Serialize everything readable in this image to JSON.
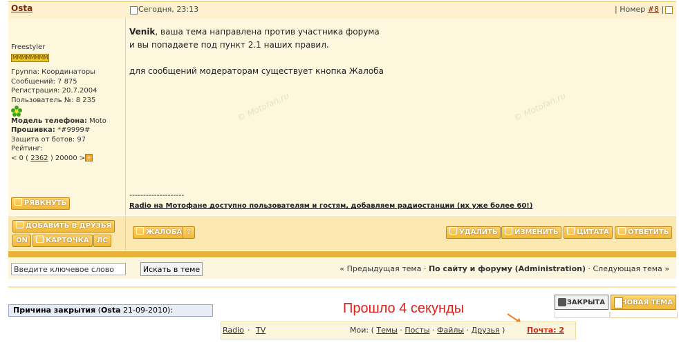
{
  "post": {
    "author": "Osta",
    "date": "Сегодня, 23:13",
    "number_label": "| Номер",
    "number_link": "#8",
    "number_sep": "|",
    "message": {
      "mention": "Venik",
      "line1_rest": ", ваша тема направлена против участника форума",
      "line2": "и вы попадаете под пункт 2.1 наших правил.",
      "line3": "для сообщений модераторам существует кнопка Жалоба"
    },
    "signature": {
      "divider": "--------------------",
      "text": "Radio на Мотофане доступно пользователям и гостям, добавляем радиостанции (их уже более 60!)"
    },
    "watermark": "© Motofan.ru"
  },
  "profile": {
    "title": "Freestyler",
    "rank_badge": "MMMMMMMM",
    "group": "Группа: Координаторы",
    "messages": "Сообщений: 7 875",
    "registered": "Регистрация: 20.7.2004",
    "user_number": "Пользователь №: 8 235",
    "phone_label": "Модель телефона:",
    "phone_value": "Moto",
    "firmware_label": "Прошивка:",
    "firmware_value": "*#9999#",
    "bot_protection": "Защита от ботов: 97",
    "rating_label": "Рейтинг:",
    "rating_left": "< 0 (",
    "rating_value": "2362",
    "rating_right": ") 20000 >",
    "icon_flower": "flower-icon",
    "icon_plus": "plus-icon"
  },
  "buttons": {
    "burp": "РЯВКНУТЬ",
    "add_friend": "ДОБАВИТЬ В ДРУЗЬЯ",
    "on": "ON",
    "card": "КАРТОЧКА",
    "pm": "ЛС",
    "complaint": "ЖАЛОБА",
    "delete": "УДАЛИТЬ",
    "edit": "ИЗМЕНИТЬ",
    "quote": "ЦИТАТА",
    "reply": "ОТВЕТИТЬ"
  },
  "search": {
    "placeholder": "Введите ключевое слово",
    "button": "Искать в теме"
  },
  "topic_nav": {
    "prev": "« Предыдущая тема",
    "sep1": "·",
    "current": "По сайту и форуму (Administration)",
    "sep2": "·",
    "next": "Следующая тема »"
  },
  "closure": {
    "label": "Причина закрытия",
    "author_open": "(",
    "author": "Osta",
    "date_rest": " 21-09-2010):"
  },
  "topic_buttons": {
    "closed": "ЗАКРЫТА",
    "new_topic": "НОВАЯ ТЕМА"
  },
  "notice": "Прошло 4 секунды",
  "footer": {
    "radio": "Radio",
    "dot1": "·",
    "tv": "TV",
    "my_label": "Мои:",
    "open_paren": "(",
    "topics": "Темы",
    "dot2": "·",
    "posts": "Посты",
    "dot3": "·",
    "files": "Файлы",
    "dot4": "·",
    "friends": "Друзья",
    "close_paren": ")",
    "mail": "Почта: 2"
  },
  "colors": {
    "accent_yellow": "#f0b838",
    "author_brown": "#7b2a0a",
    "notice_red": "#e0201a",
    "mail_red": "#d2261a"
  }
}
